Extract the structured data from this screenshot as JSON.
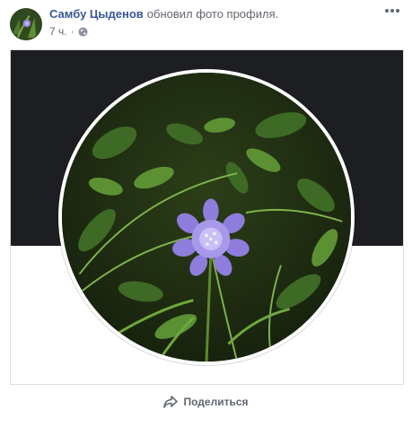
{
  "post": {
    "author": "Самбу Цыденов",
    "action": "обновил фото профиля.",
    "time": "7 ч.",
    "separator": "·",
    "privacy_icon": "globe-icon",
    "more_icon": "more-options-icon"
  },
  "footer": {
    "share_label": "Поделиться",
    "share_icon": "share-arrow-icon"
  },
  "colors": {
    "author_link": "#385898",
    "cover_band": "#1c1e21",
    "flower": "#8b7ad8"
  }
}
